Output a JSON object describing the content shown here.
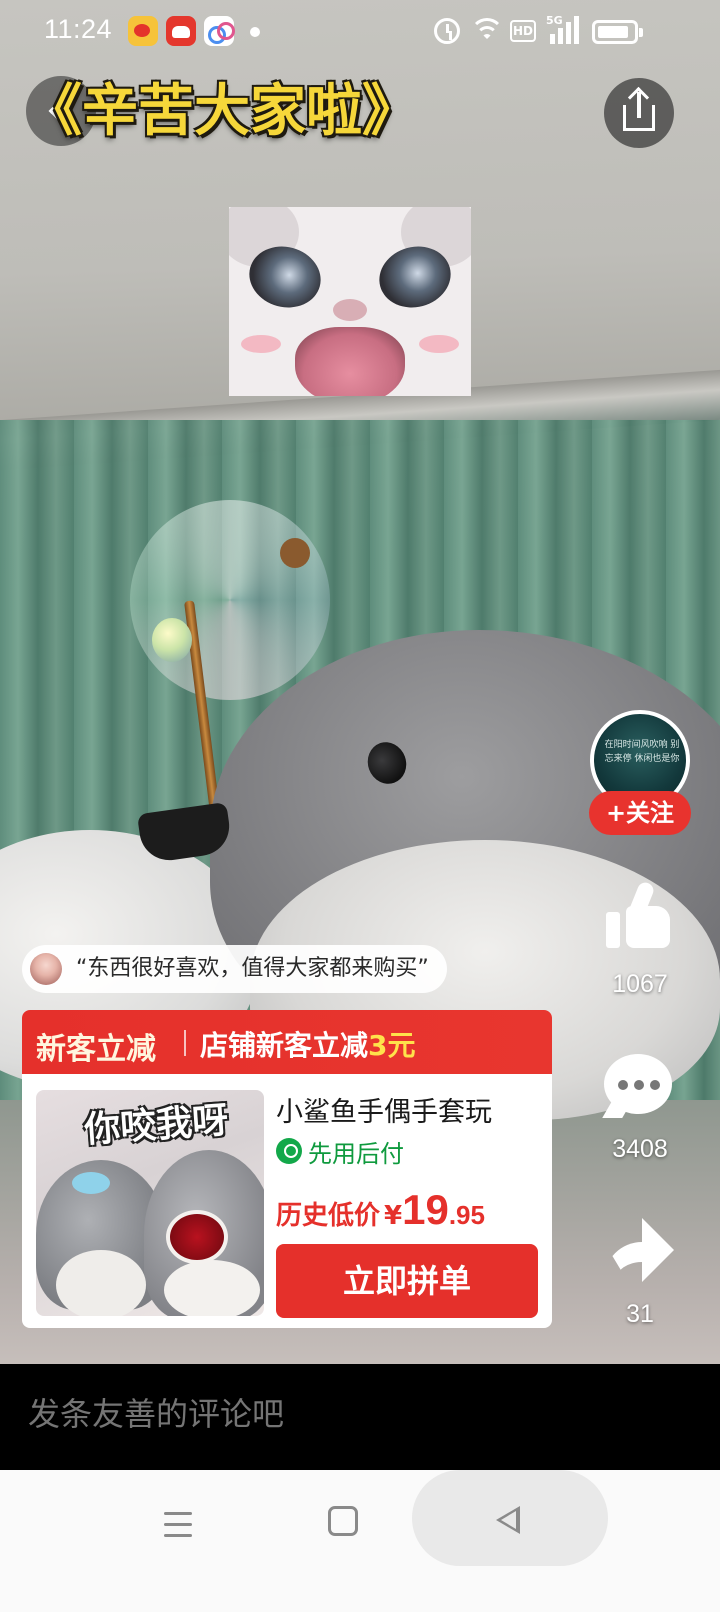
{
  "status_bar": {
    "time": "11:24",
    "network_label": "HD",
    "signal_label": "5G",
    "icons": [
      "weibo-app-icon",
      "red-app-icon",
      "baidu-netdisk-app-icon",
      "notification-dot-icon",
      "alarm-icon",
      "wifi-icon",
      "hd-icon",
      "5g-signal-icon",
      "battery-icon"
    ]
  },
  "video": {
    "title": "《辛苦大家啦》"
  },
  "right_rail": {
    "avatar_text": "在阳时间风吹响 别忘来停 休闲也是你",
    "follow_label": "+关注",
    "like_count": "1067",
    "comment_count": "3408",
    "share_count": "31"
  },
  "review": {
    "text": "“东西很好喜欢，值得大家都来购买”"
  },
  "product_card": {
    "promo_tag": "新客立减",
    "promo_text": "店铺新客立减",
    "promo_amount": "3元",
    "image_caption": "你咬我呀",
    "name": "小鲨鱼手偶手套玩",
    "pay_later": "先用后付",
    "price_label": "历史低价",
    "price_symbol": "¥",
    "price_int": "19",
    "price_dec": ".95",
    "buy_label": "立即拼单",
    "colors": {
      "accent": "#e5302b",
      "promo_amount": "#ffe24b",
      "pay_later": "#0f9a3e"
    }
  },
  "comment_bar": {
    "placeholder": "发条友善的评论吧"
  }
}
